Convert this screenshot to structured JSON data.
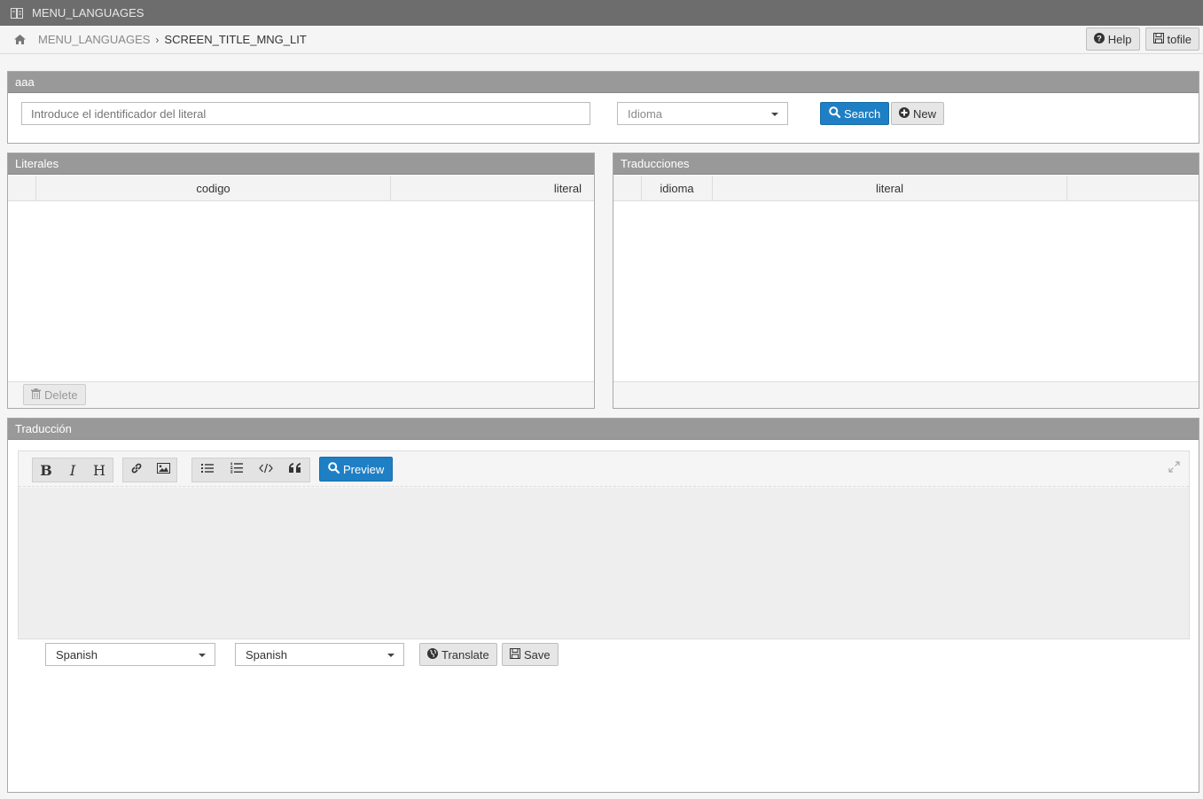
{
  "topbar": {
    "title": "MENU_LANGUAGES"
  },
  "breadcrumb": {
    "first": "MENU_LANGUAGES",
    "separator": "›",
    "current": "SCREEN_TITLE_MNG_LIT"
  },
  "actions": {
    "help_label": "Help",
    "tofile_label": "tofile"
  },
  "search_panel": {
    "title": "aaa",
    "literal_input_placeholder": "Introduce el identificador del literal",
    "language_select_placeholder": "Idioma",
    "search_label": "Search",
    "new_label": "New"
  },
  "literales_panel": {
    "title": "Literales",
    "columns": [
      "codigo",
      "literal"
    ],
    "rows": [],
    "delete_label": "Delete"
  },
  "traducciones_panel": {
    "title": "Traducciones",
    "columns": [
      "idioma",
      "literal"
    ],
    "rows": []
  },
  "traduccion_panel": {
    "title": "Traducción",
    "toolbar": {
      "bold": "B",
      "italic": "I",
      "heading": "H",
      "preview_label": "Preview"
    },
    "source_language": "Spanish",
    "target_language": "Spanish",
    "translate_label": "Translate",
    "save_label": "Save"
  },
  "colors": {
    "topbar": "#6d6d6d",
    "panel_header": "#999999",
    "primary_button": "#1f7fc4",
    "editor_background": "#eeeeee"
  }
}
